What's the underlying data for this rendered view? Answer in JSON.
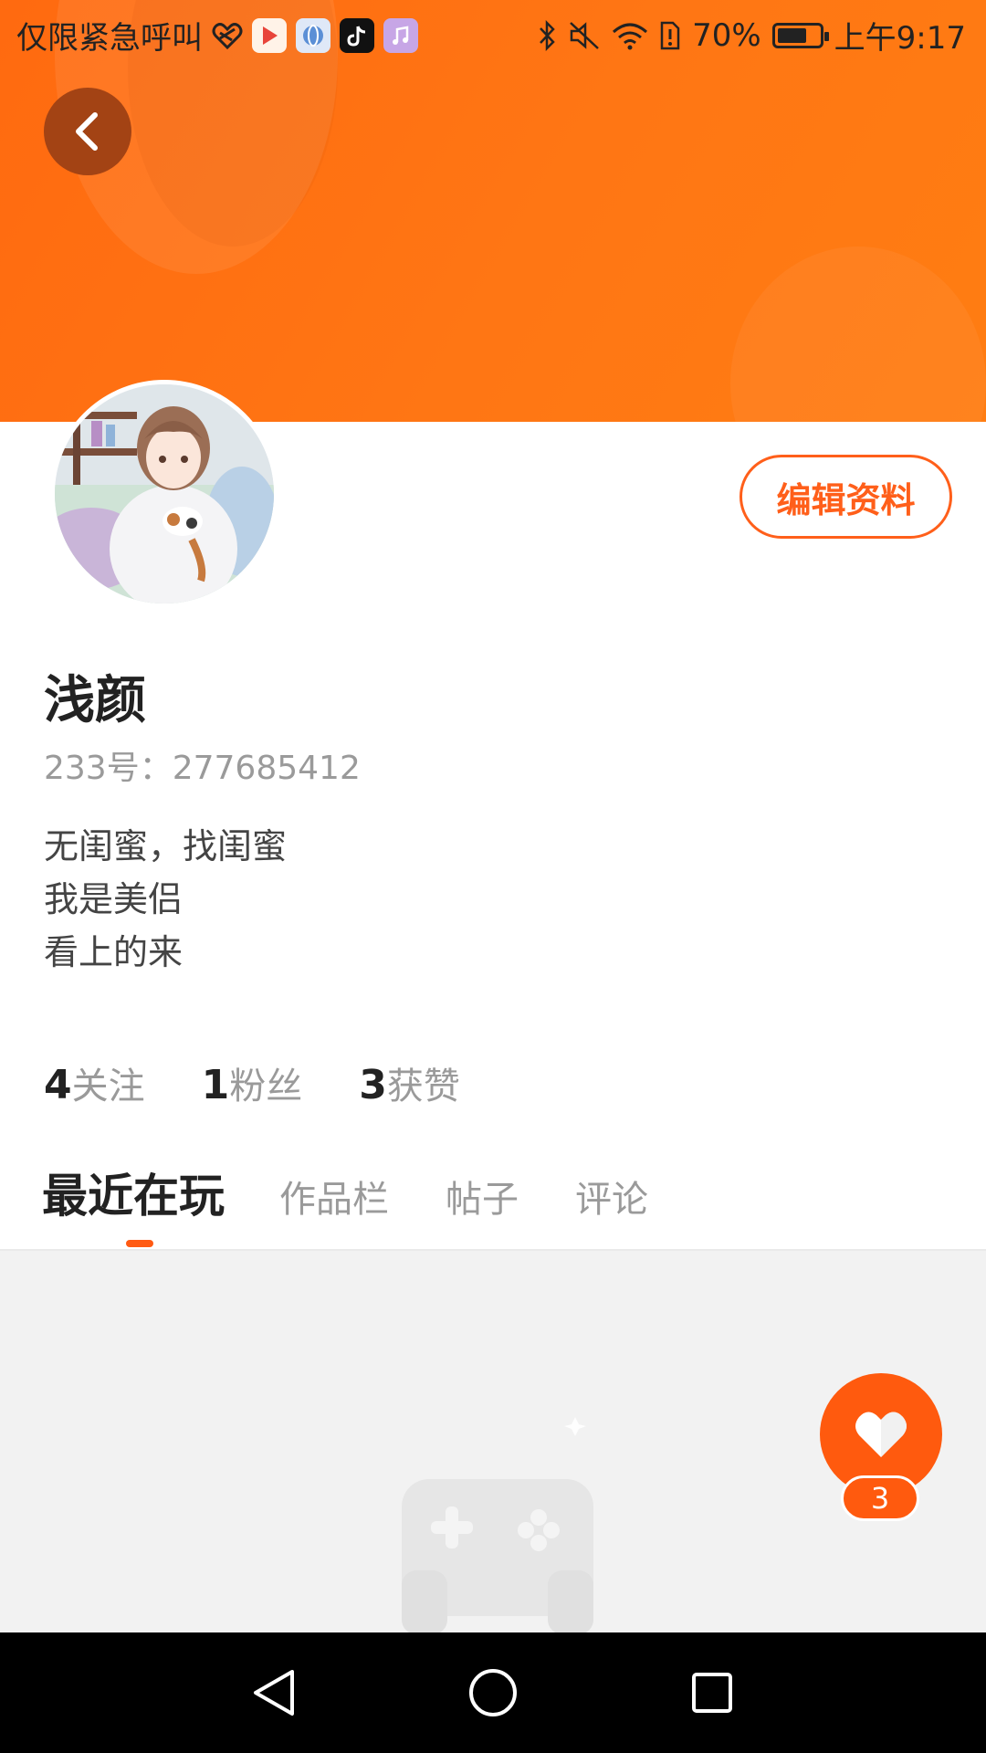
{
  "status_bar": {
    "carrier": "仅限紧急呼叫",
    "battery_percent": "70%",
    "battery_level": 0.7,
    "time": "上午9:17",
    "icons": [
      "heart-link-icon",
      "video-app-icon",
      "browser-app-icon",
      "tiktok-app-icon",
      "music-app-icon",
      "bluetooth-icon",
      "mute-icon",
      "wifi-icon",
      "sim-alert-icon",
      "battery-icon"
    ]
  },
  "header": {
    "back_icon": "chevron-left-icon",
    "edit_label": "编辑资料"
  },
  "profile": {
    "name": "浅颜",
    "id_text": "233号：277685412",
    "bio": [
      "无闺蜜，找闺蜜",
      "我是美侣",
      "看上的来"
    ]
  },
  "stats": [
    {
      "num": "4",
      "label": "关注"
    },
    {
      "num": "1",
      "label": "粉丝"
    },
    {
      "num": "3",
      "label": "获赞"
    }
  ],
  "tabs": [
    {
      "label": "最近在玩",
      "active": true
    },
    {
      "label": "作品栏",
      "active": false
    },
    {
      "label": "帖子",
      "active": false
    },
    {
      "label": "评论",
      "active": false
    }
  ],
  "like": {
    "icon": "heart-icon",
    "count": "3"
  },
  "colors": {
    "accent": "#ff5a0e",
    "header": "#ff7614"
  },
  "nav_bar": [
    "back-triangle-icon",
    "home-circle-icon",
    "recents-square-icon"
  ]
}
